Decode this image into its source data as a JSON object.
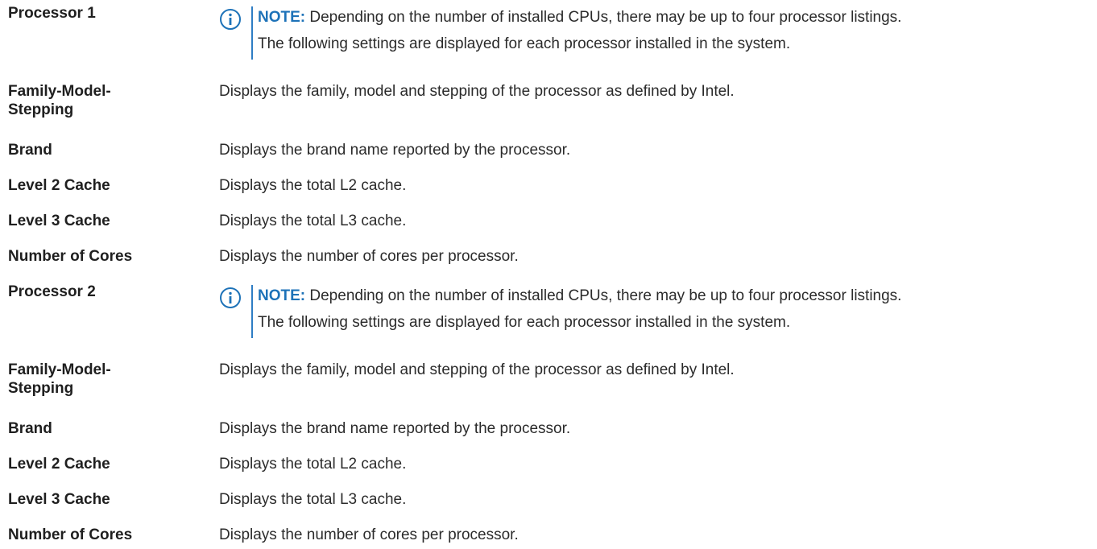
{
  "note_color": "#1d72b8",
  "rows": [
    {
      "term": "Processor 1",
      "note": {
        "icon": "info-icon",
        "label": "NOTE:",
        "line1": "Depending on the number of installed CPUs, there may be up to four processor listings.",
        "line2": "The following settings are displayed for each processor installed in the system."
      }
    },
    {
      "term": "Family-Model-Stepping",
      "desc": "Displays the family, model and stepping of the processor as defined by Intel."
    },
    {
      "term": "Brand",
      "desc": "Displays the brand name reported by the processor."
    },
    {
      "term": "Level 2 Cache",
      "desc": "Displays the total L2 cache."
    },
    {
      "term": "Level 3 Cache",
      "desc": "Displays the total L3 cache."
    },
    {
      "term": "Number of Cores",
      "desc": "Displays the number of cores per processor."
    },
    {
      "term": "Processor 2",
      "note": {
        "icon": "info-icon",
        "label": "NOTE:",
        "line1": "Depending on the number of installed CPUs, there may be up to four processor listings.",
        "line2": "The following settings are displayed for each processor installed in the system."
      }
    },
    {
      "term": "Family-Model-Stepping",
      "desc": "Displays the family, model and stepping of the processor as defined by Intel."
    },
    {
      "term": "Brand",
      "desc": "Displays the brand name reported by the processor."
    },
    {
      "term": "Level 2 Cache",
      "desc": "Displays the total L2 cache."
    },
    {
      "term": "Level 3 Cache",
      "desc": "Displays the total L3 cache."
    },
    {
      "term": "Number of Cores",
      "desc": "Displays the number of cores per processor."
    }
  ]
}
